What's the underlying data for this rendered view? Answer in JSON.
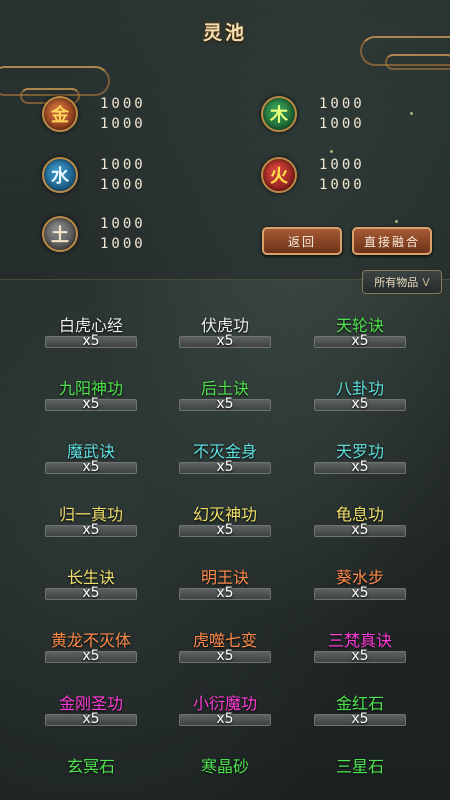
{
  "title": "灵池",
  "resources": [
    {
      "id": "gold",
      "glyph": "金",
      "values": [
        "1000",
        "1000"
      ]
    },
    {
      "id": "wood",
      "glyph": "木",
      "values": [
        "1000",
        "1000"
      ]
    },
    {
      "id": "water",
      "glyph": "水",
      "values": [
        "1000",
        "1000"
      ]
    },
    {
      "id": "fire",
      "glyph": "火",
      "values": [
        "1000",
        "1000"
      ]
    },
    {
      "id": "earth",
      "glyph": "土",
      "values": [
        "1000",
        "1000"
      ]
    }
  ],
  "buttons": {
    "back_label": "返回",
    "fuse_label": "直接融合"
  },
  "filter": {
    "label": "所有物品",
    "caret": "V"
  },
  "colors": {
    "white": "#eeeeee",
    "green": "#4fe44f",
    "cyan": "#5fe0e0",
    "yellow": "#f0df6a",
    "orange": "#ff8a4a",
    "magenta": "#ff3cd8"
  },
  "items": [
    {
      "name": "白虎心经",
      "count": "x5",
      "color": "#eeeeee"
    },
    {
      "name": "伏虎功",
      "count": "x5",
      "color": "#eeeeee"
    },
    {
      "name": "天轮诀",
      "count": "x5",
      "color": "#4fe44f"
    },
    {
      "name": "九阳神功",
      "count": "x5",
      "color": "#4fe44f"
    },
    {
      "name": "后土诀",
      "count": "x5",
      "color": "#4fe44f"
    },
    {
      "name": "八卦功",
      "count": "x5",
      "color": "#5fe0e0"
    },
    {
      "name": "魔武诀",
      "count": "x5",
      "color": "#5fe0e0"
    },
    {
      "name": "不灭金身",
      "count": "x5",
      "color": "#5fe0e0"
    },
    {
      "name": "天罗功",
      "count": "x5",
      "color": "#5fe0e0"
    },
    {
      "name": "归一真功",
      "count": "x5",
      "color": "#f0df6a"
    },
    {
      "name": "幻灭神功",
      "count": "x5",
      "color": "#f0df6a"
    },
    {
      "name": "龟息功",
      "count": "x5",
      "color": "#f0df6a"
    },
    {
      "name": "长生诀",
      "count": "x5",
      "color": "#f0df6a"
    },
    {
      "name": "明王诀",
      "count": "x5",
      "color": "#ff8a4a"
    },
    {
      "name": "葵水步",
      "count": "x5",
      "color": "#ff8a4a"
    },
    {
      "name": "黄龙不灭体",
      "count": "x5",
      "color": "#ff8a4a"
    },
    {
      "name": "虎噬七变",
      "count": "x5",
      "color": "#ff8a4a"
    },
    {
      "name": "三梵真诀",
      "count": "x5",
      "color": "#ff3cd8"
    },
    {
      "name": "金刚圣功",
      "count": "x5",
      "color": "#ff3cd8"
    },
    {
      "name": "小衍魔功",
      "count": "x5",
      "color": "#ff3cd8"
    },
    {
      "name": "金红石",
      "count": "x5",
      "color": "#4fe44f"
    },
    {
      "name": "玄冥石",
      "count": "",
      "color": "#4fe44f"
    },
    {
      "name": "寒晶砂",
      "count": "",
      "color": "#4fe44f"
    },
    {
      "name": "三星石",
      "count": "",
      "color": "#4fe44f"
    }
  ]
}
